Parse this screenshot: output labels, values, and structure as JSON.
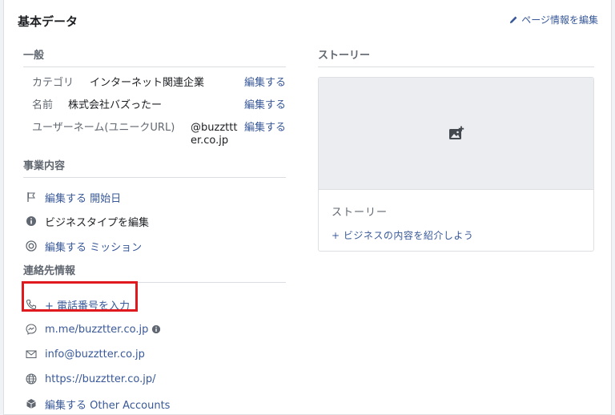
{
  "header": {
    "title": "基本データ",
    "edit_page_info": "ページ情報を編集"
  },
  "general": {
    "section_title": "一般",
    "category": {
      "key": "カテゴリ",
      "value": "インターネット関連企業",
      "edit": "編集する"
    },
    "name": {
      "key": "名前",
      "value": "株式会社バズったー",
      "edit": "編集する"
    },
    "username": {
      "key": "ユーザーネーム(ユニークURL)",
      "value": "@buzzttter.co.jp",
      "edit": "編集する"
    }
  },
  "business": {
    "section_title": "事業内容",
    "items": [
      {
        "label": "編集する 開始日",
        "icon": "flag-icon"
      },
      {
        "label": "ビジネスタイプを編集",
        "icon": "info-icon"
      },
      {
        "label": "編集する ミッション",
        "icon": "mission-icon"
      }
    ]
  },
  "contact": {
    "section_title": "連絡先情報",
    "items": [
      {
        "label": "+ 電話番号を入力",
        "icon": "phone-icon"
      },
      {
        "label": "m.me/buzztter.co.jp",
        "icon": "messenger-icon"
      },
      {
        "label": "info@buzztter.co.jp",
        "icon": "envelope-icon"
      },
      {
        "label": "https://buzztter.co.jp/",
        "icon": "globe-icon"
      },
      {
        "label": "編集する Other Accounts",
        "icon": "cube-icon"
      }
    ]
  },
  "story": {
    "section_title": "ストーリー",
    "box_label": "ストーリー",
    "add_label": "+ ビジネスの内容を紹介しよう"
  },
  "colors": {
    "link": "#385898",
    "highlight": "#e0191f"
  }
}
